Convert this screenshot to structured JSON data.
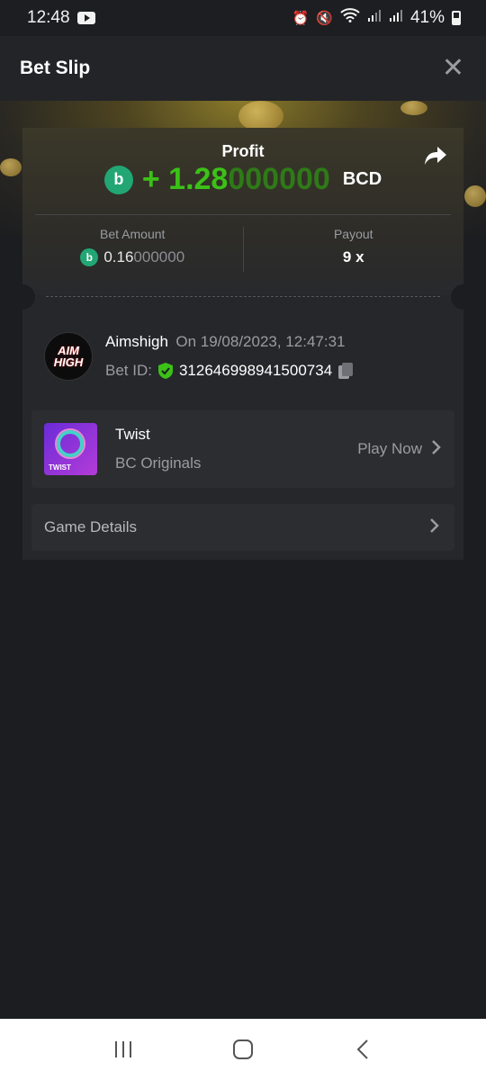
{
  "status_bar": {
    "time": "12:48",
    "battery": "41%",
    "icons": [
      "youtube-icon",
      "alarm-icon",
      "mute-icon",
      "wifi-icon",
      "signal-icon",
      "signal-icon",
      "battery-icon"
    ]
  },
  "header": {
    "title": "Bet Slip"
  },
  "profit": {
    "label": "Profit",
    "sign": "+ ",
    "amount_main": "1.28",
    "amount_trailing": "000000",
    "currency": "BCD"
  },
  "bet_amount": {
    "label": "Bet Amount",
    "value_main": "0.16",
    "value_trailing": "000000"
  },
  "payout": {
    "label": "Payout",
    "value": "9 x"
  },
  "bettor": {
    "avatar_text": "AIM HIGH",
    "name": "Aimshigh",
    "date": "On 19/08/2023, 12:47:31",
    "bet_id_label": "Bet ID:",
    "bet_id": "312646998941500734"
  },
  "game": {
    "name": "Twist",
    "provider": "BC Originals",
    "play_label": "Play Now",
    "thumb_label": "TWIST"
  },
  "details": {
    "label": "Game Details"
  },
  "colors": {
    "profit_green": "#3bc117",
    "coin_green": "#21a674",
    "background": "#1c1d20"
  }
}
